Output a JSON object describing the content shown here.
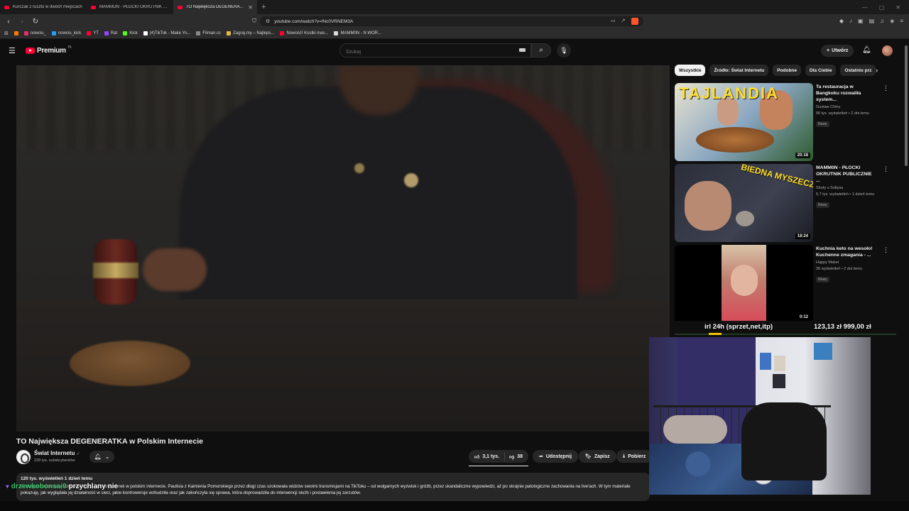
{
  "browser": {
    "tabs": [
      {
        "title": "Kurczak z rusztu w dwóch miejscach"
      },
      {
        "title": "MAMMON - PŁOCKI OKRUTNIK PUB"
      },
      {
        "title": "TO Największa DEGENERATK"
      }
    ],
    "url": "youtube.com/watch?v=lNc0VRNEM3A",
    "bookmarks": [
      {
        "label": "nowciu_",
        "color": "#e1306c"
      },
      {
        "label": "nowciu_kick",
        "color": "#1da1f2"
      },
      {
        "label": "YT",
        "color": "#ff0033"
      },
      {
        "label": "Rat",
        "color": "#9146ff"
      },
      {
        "label": "Kick",
        "color": "#53fc18"
      },
      {
        "label": "(4)TikTok - Make Yo...",
        "color": "#ffffff"
      },
      {
        "label": "Filman.cc",
        "color": "#888888"
      },
      {
        "label": "Zagraj.my – Najleps...",
        "color": "#e9b64a"
      },
      {
        "label": "Nowość! Kostki mas...",
        "color": "#ff0033"
      },
      {
        "label": "MAMM0N - N WOR...",
        "color": "#dddddd"
      }
    ]
  },
  "masthead": {
    "logo_text": "Premium",
    "logo_region": "PL",
    "search_placeholder": "Szukaj",
    "create_label": "Utwórz"
  },
  "video": {
    "title": "TO Największa DEGENERATKA w Polskim Internecie",
    "channel": "Świat Internetu",
    "subscribers": "228 tys. subskrybentów",
    "likes": "3,1 tys.",
    "dislikes": "38",
    "share_label": "Udostępnij",
    "save_label": "Zapisz",
    "download_label": "Pobierz",
    "stats": "120 tys. wyświetleń  1 dzień temu",
    "description": "Poznajcie najbardziej kontrowersyjną patostreamerek w polskim internecie. Paulisia z Kamienia Pomorskiego przez długi czas szokowała widzów swoimi transmisjami na TikToku – od wulgarnych wyzwisk i gróźb, przez skandaliczne wypowiedzi, aż po skrajnie patologiczne zachowania na live'ach. W tym materiale pokazuję, jak wyglądała jej działalność w sieci, jakie kontrowersje wzbudziła oraz jak zakończyła się sprawa, która doprowadziła do interwencji służb i postawienia jej zarzutów."
  },
  "sidebar": {
    "chips": [
      "Wszystkie",
      "Źródło: Świat Internetu",
      "Podobne",
      "Dla Ciebie",
      "Ostatnio prz"
    ],
    "recommendations": [
      {
        "title": "Ta restauracja w Bangkoku rozwaliła system...",
        "channel": "Gustaw Chiny",
        "meta": "90 tys. wyświetleń • 2 dni temu",
        "badge": "Nowy",
        "duration": "20:18",
        "thumb_text": "TAJLANDIA"
      },
      {
        "title": "MAMM0N - PŁOCKI OKRUTNIK PUBLICZNIE ...",
        "channel": "Shoty u Sołtysa",
        "meta": "5,7 tys. wyświetleń • 1 dzień temu",
        "badge": "Nowy",
        "duration": "18:24",
        "thumb_text": "BIEDNA MYSZECZKA"
      },
      {
        "title": "Kuchnia keto na wesoło! Kuchenne zmagania - ...",
        "channel": "Happy Maker",
        "meta": "35 wyświetleń • 2 dni temu",
        "badge": "Nowy",
        "duration": "0:12",
        "thumb_text": ""
      }
    ]
  },
  "overlay": {
    "goal_label": "irl 24h (sprzet,net,itp)",
    "goal_amount": "123,13 zł     999,00 zł",
    "goal_progress": 0.12,
    "chat_user": "drzewkobonsai0",
    "chat_message": "przychlany nie"
  }
}
